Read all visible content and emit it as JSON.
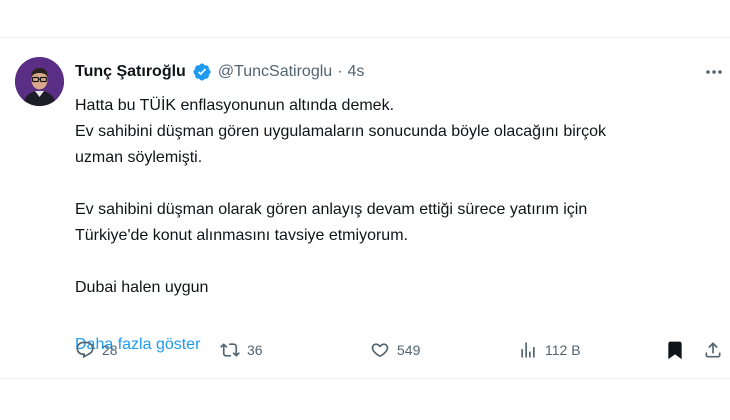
{
  "author": {
    "display_name": "Tunç Şatıroğlu",
    "handle": "@TuncSatiroglu",
    "separator": "·",
    "time": "4s"
  },
  "tweet": {
    "lines": [
      "Hatta bu TÜİK enflasyonunun altında demek.",
      "Ev sahibini düşman gören uygulamaların sonucunda böyle olacağını birçok",
      "uzman söylemişti.",
      "",
      "Ev sahibini düşman olarak gören anlayış devam ettiği sürece yatırım için",
      "Türkiye'de konut alınmasını tavsiye etmiyorum.",
      "",
      "Dubai halen uygun"
    ],
    "show_more": "Daha fazla göster"
  },
  "actions": {
    "replies": "28",
    "retweets": "36",
    "likes": "549",
    "views": "112 B"
  },
  "colors": {
    "accent": "#1d9bf0",
    "text": "#0f1419",
    "muted": "#536471",
    "divider": "#eff3f4"
  },
  "icons": [
    "verified-badge-icon",
    "more-icon",
    "reply-icon",
    "retweet-icon",
    "like-icon",
    "views-icon",
    "bookmark-icon",
    "share-icon"
  ]
}
